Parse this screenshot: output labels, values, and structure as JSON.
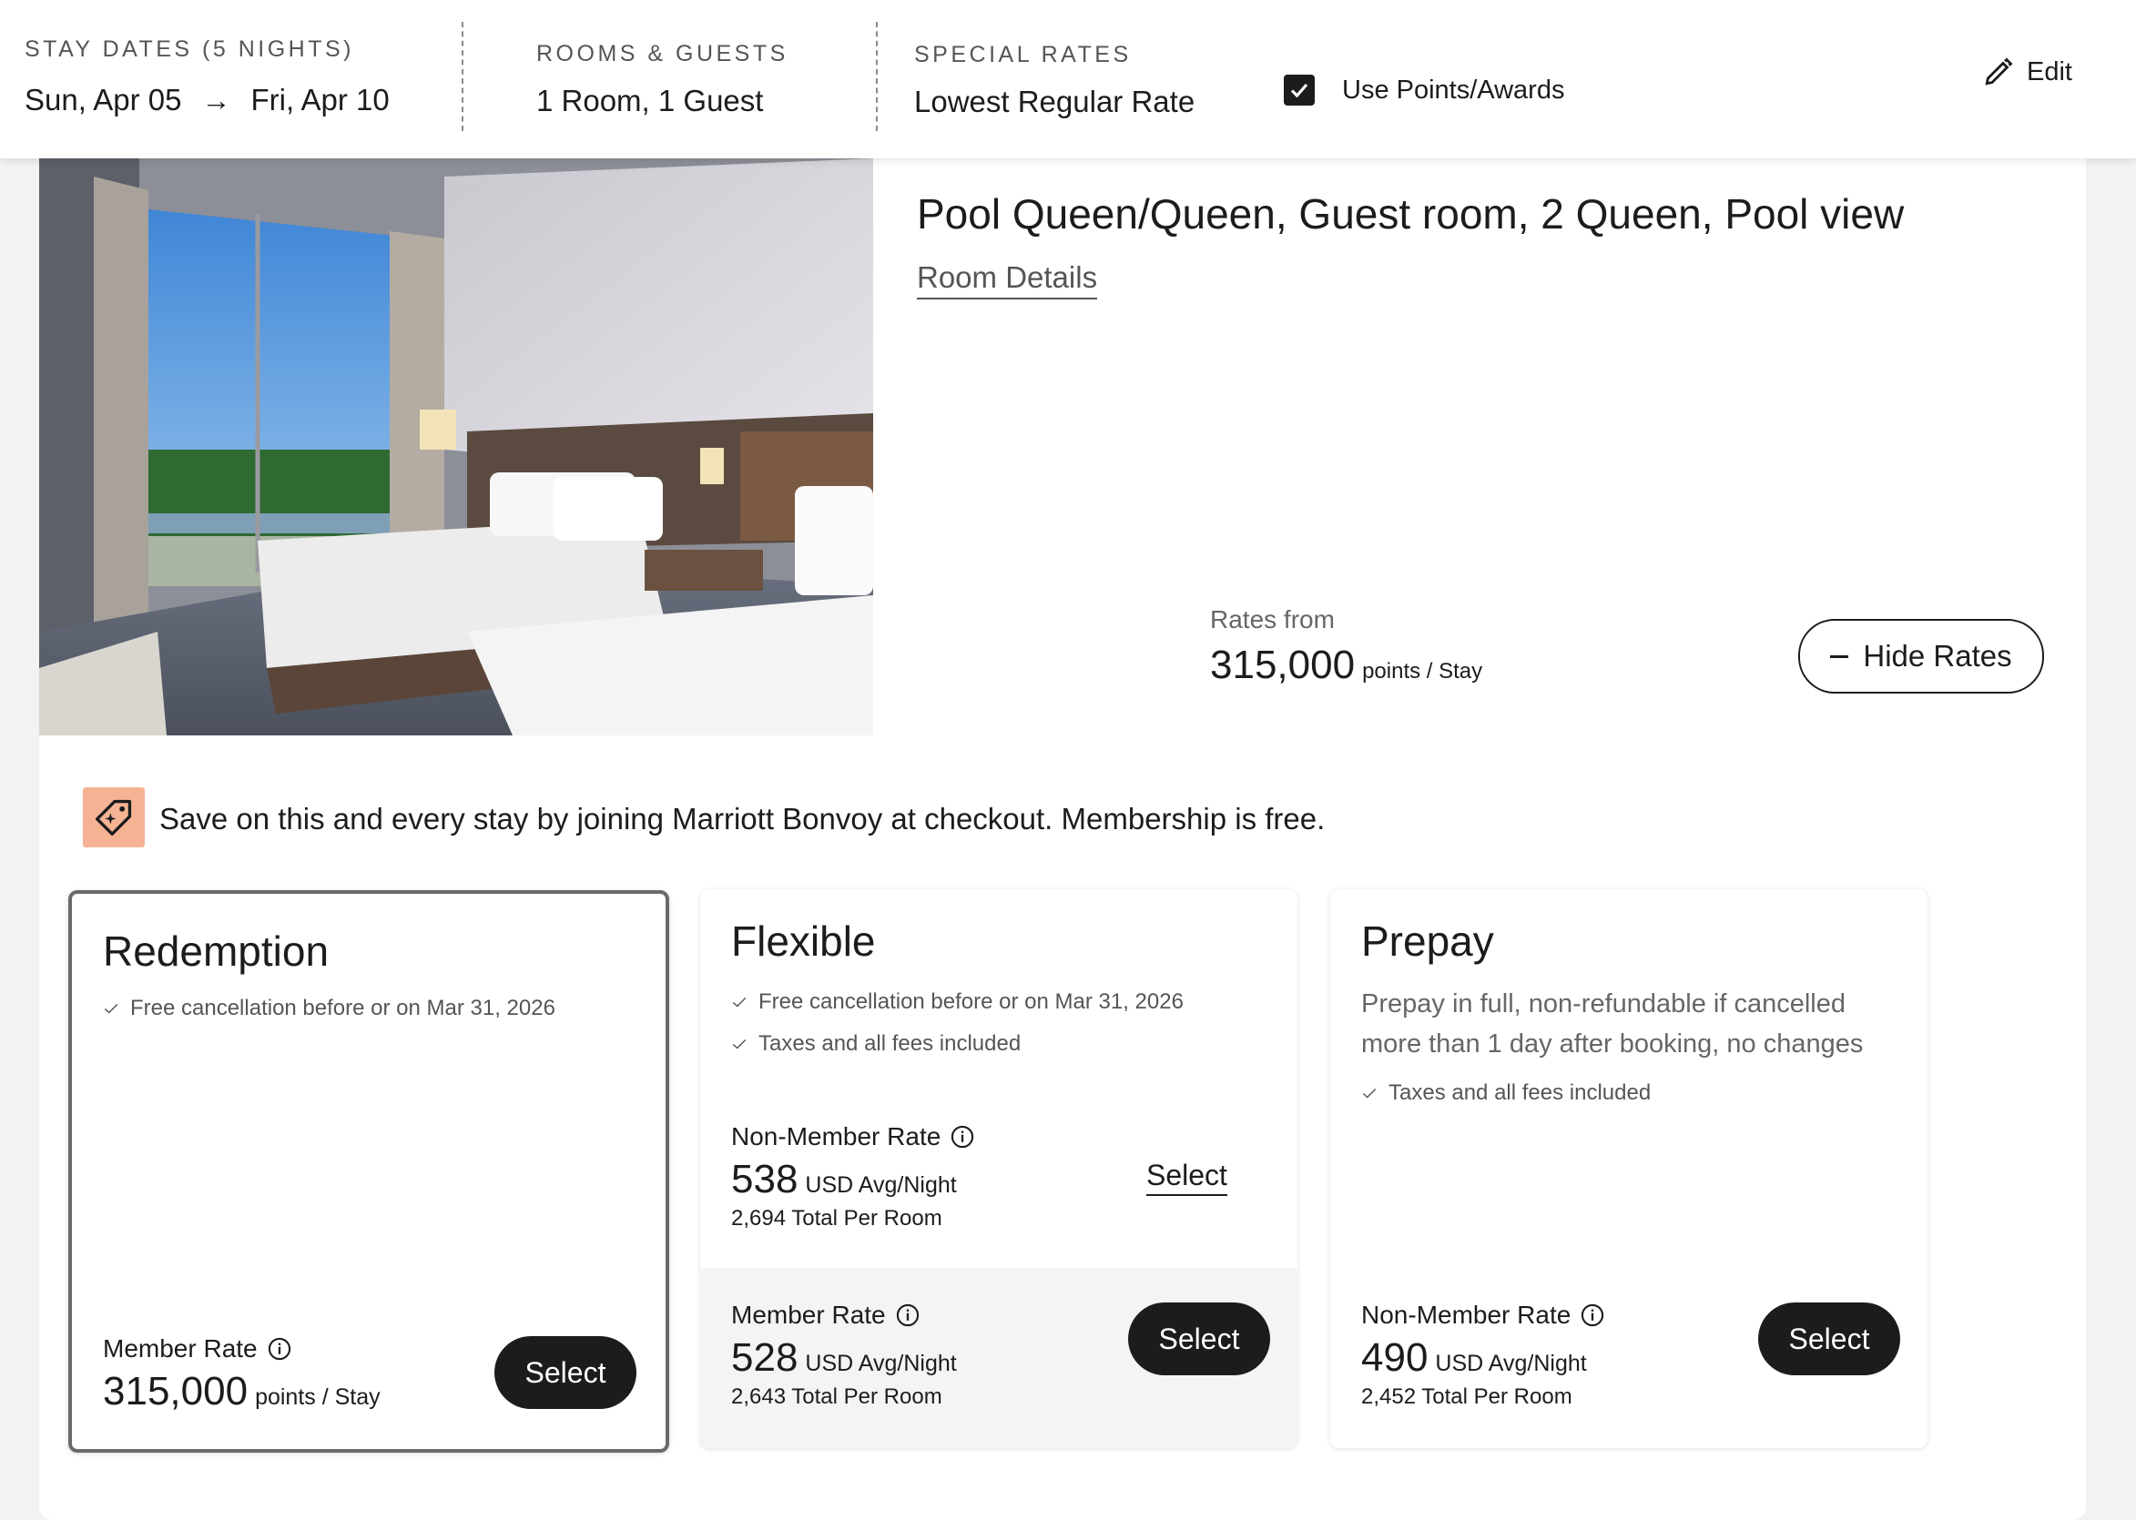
{
  "header": {
    "stay_label": "STAY DATES (5 NIGHTS)",
    "checkin": "Sun, Apr 05",
    "arrow": "→",
    "checkout": "Fri, Apr 10",
    "rooms_label": "ROOMS & GUESTS",
    "rooms_value": "1 Room, 1 Guest",
    "special_label": "SPECIAL RATES",
    "special_value": "Lowest Regular Rate",
    "points_label": "Use Points/Awards",
    "points_checked": true,
    "edit_label": "Edit"
  },
  "room": {
    "title": "Pool Queen/Queen, Guest room, 2 Queen, Pool view",
    "details_link": "Room Details",
    "rates_from_label": "Rates from",
    "rates_from_value": "315,000",
    "rates_from_unit": "points / Stay",
    "hide_rates_label": "Hide Rates"
  },
  "promo": {
    "text": "Save on this and every stay by joining Marriott Bonvoy at checkout. Membership is free."
  },
  "tiles": [
    {
      "title": "Redemption",
      "features": [
        "Free cancellation before or on Mar 31, 2026"
      ],
      "rate_label": "Member Rate",
      "price": "315,000",
      "unit": "points / Stay",
      "button": "Select"
    },
    {
      "title": "Flexible",
      "features": [
        "Free cancellation before or on Mar 31, 2026",
        "Taxes and all fees included"
      ],
      "nonmember": {
        "label": "Non-Member Rate",
        "price": "538",
        "unit": "USD Avg/Night",
        "total": "2,694 Total Per Room",
        "button": "Select"
      },
      "member": {
        "label": "Member Rate",
        "price": "528",
        "unit": "USD Avg/Night",
        "total": "2,643 Total Per Room",
        "button": "Select"
      }
    },
    {
      "title": "Prepay",
      "description": "Prepay in full, non-refundable if cancelled more than 1 day after booking, no changes",
      "features": [
        "Taxes and all fees included"
      ],
      "nonmember": {
        "label": "Non-Member Rate",
        "price": "490",
        "unit": "USD Avg/Night",
        "total": "2,452 Total Per Room",
        "button": "Select"
      }
    }
  ],
  "colors": {
    "accent_dark": "#1c1c1c",
    "promo_icon_bg": "#f5b394",
    "page_bg": "#f2f2f2"
  }
}
